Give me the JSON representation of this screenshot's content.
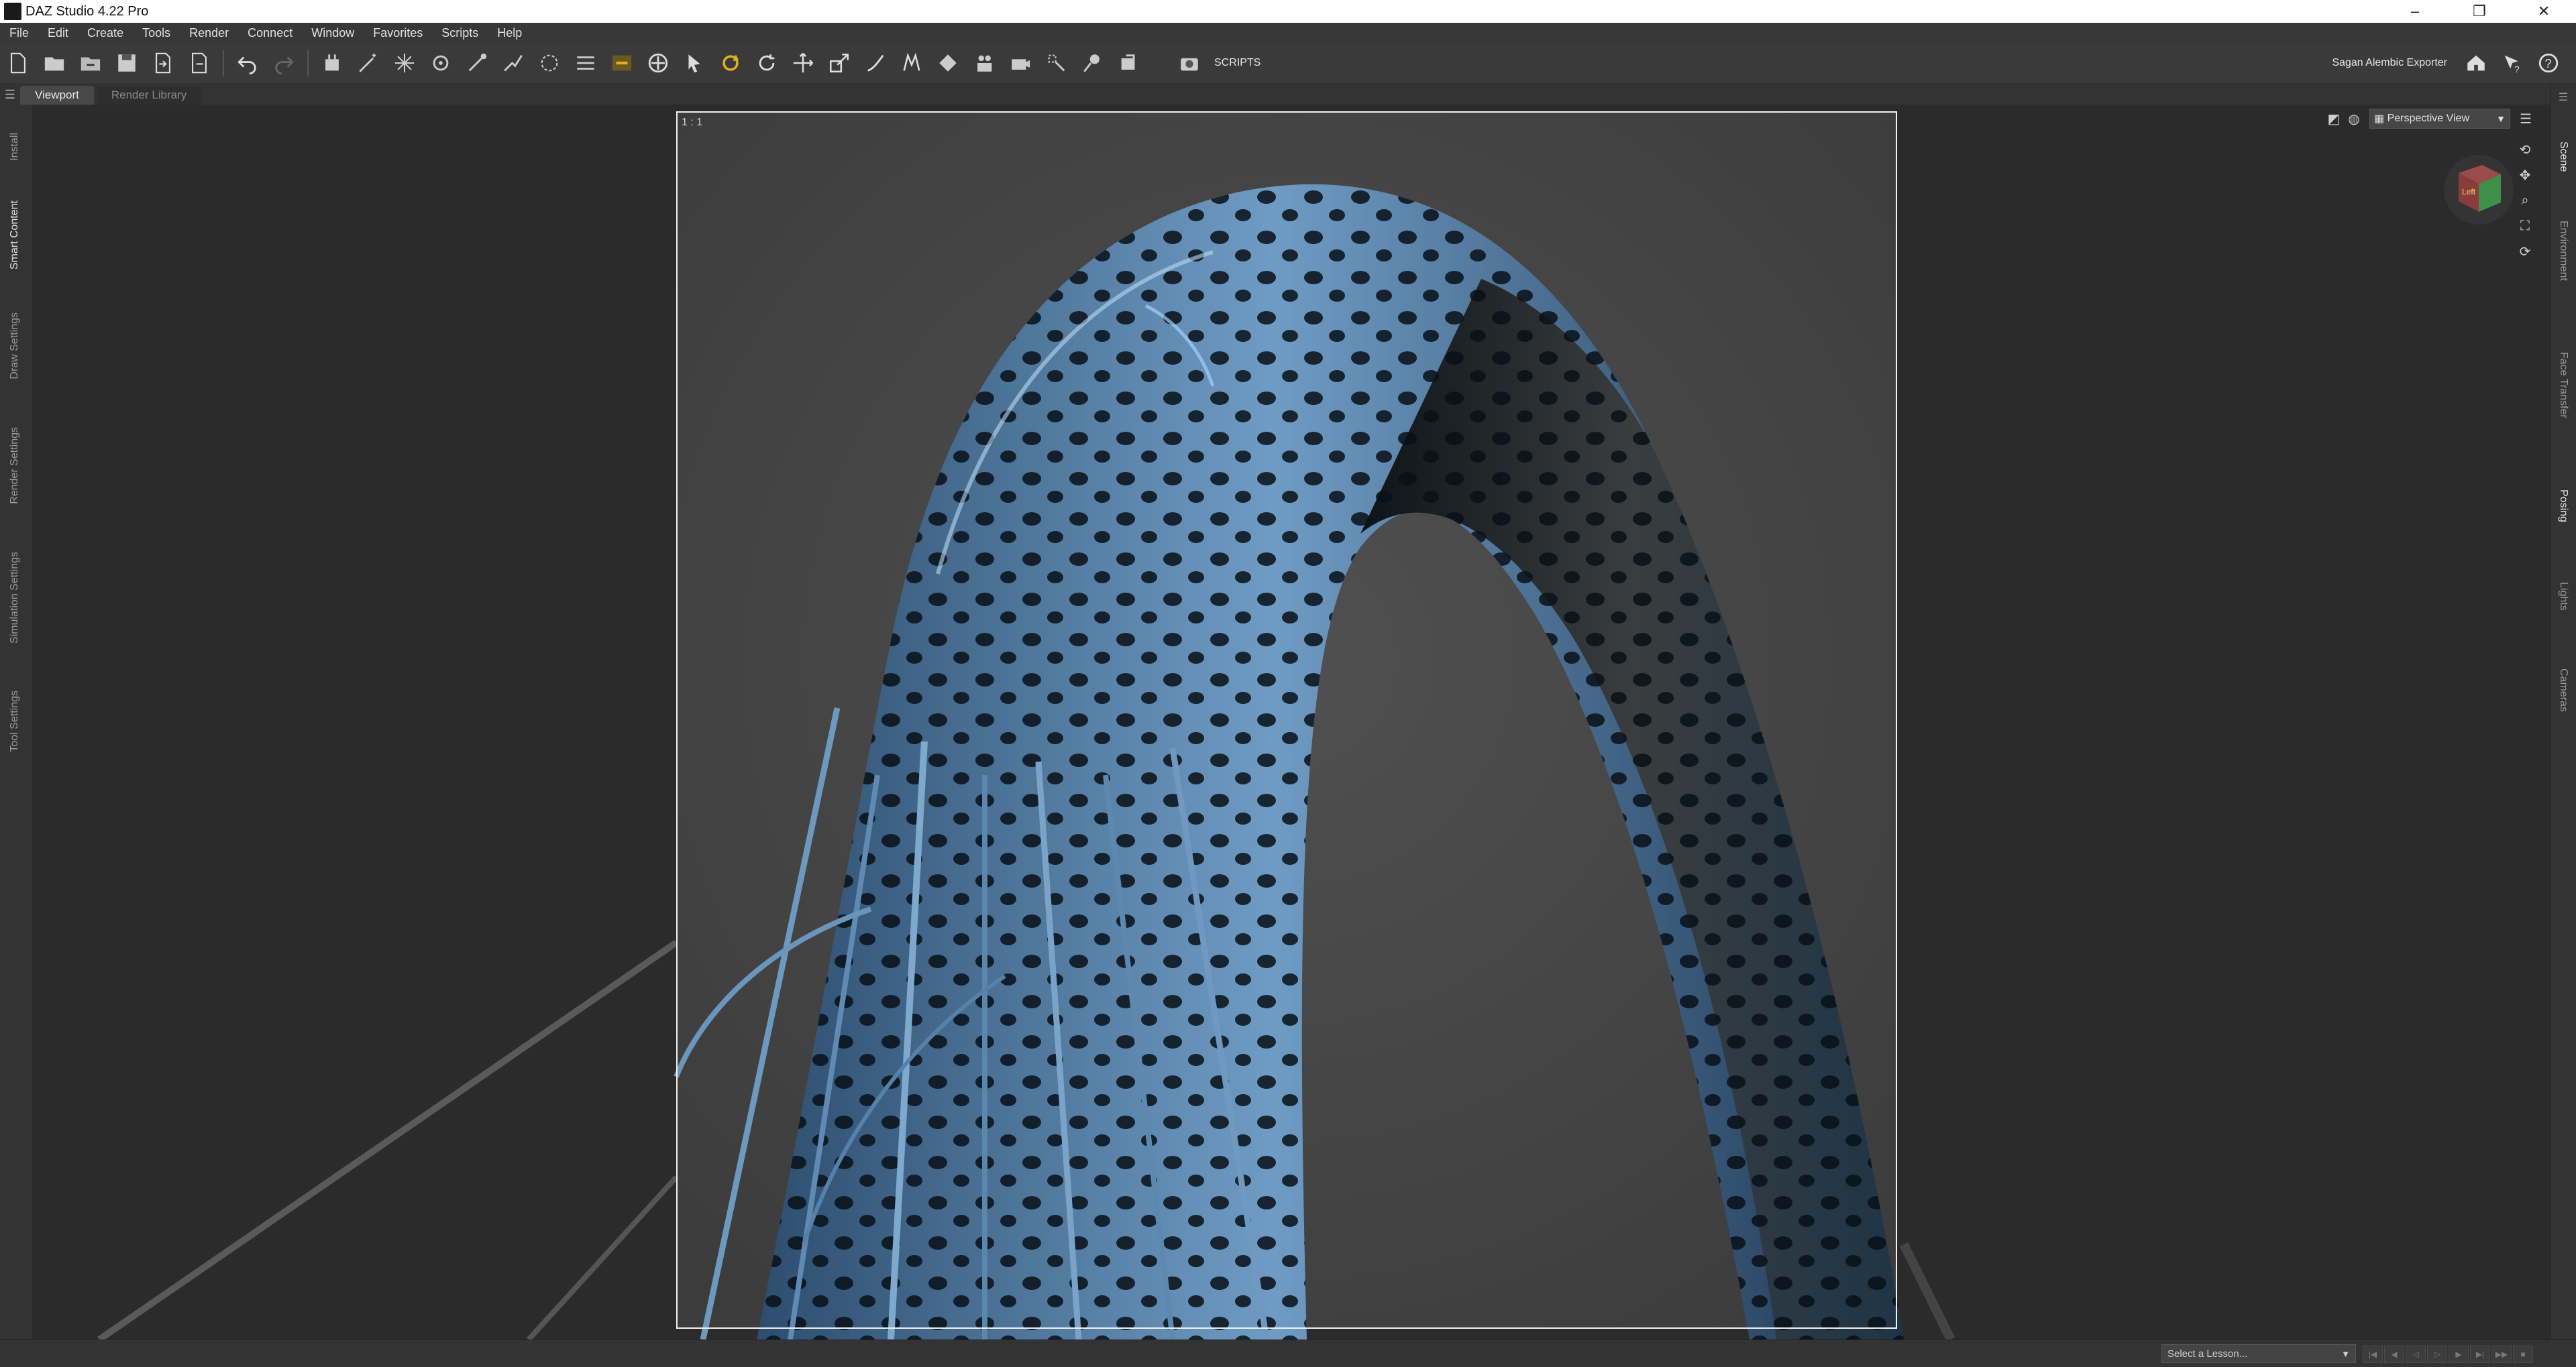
{
  "window": {
    "title": "DAZ Studio 4.22 Pro",
    "controls": [
      "–",
      "❐",
      "✕"
    ]
  },
  "menubar": {
    "items": [
      "File",
      "Edit",
      "Create",
      "Tools",
      "Render",
      "Connect",
      "Window",
      "Favorites",
      "Scripts",
      "Help"
    ]
  },
  "toolbar": {
    "scripts_label": "SCRIPTS",
    "exporter_label": "Sagan Alembic Exporter"
  },
  "tabs": {
    "viewport": "Viewport",
    "render_library": "Render Library"
  },
  "left_tabs": [
    "Install",
    "Smart Content",
    "Draw Settings",
    "Render Settings",
    "Simulation Settings",
    "Tool Settings"
  ],
  "right_tabs": [
    "Scene",
    "Environment",
    "Face Transfer",
    "Posing",
    "Lights",
    "Cameras"
  ],
  "viewport": {
    "aspect_label": "1 : 1",
    "view_select": "Perspective View",
    "cube_face_label": "Left"
  },
  "statusbar": {
    "lesson_placeholder": "Select a Lesson..."
  },
  "colors": {
    "frame": "#f2f2f2",
    "scene_background": "#4a4a4a",
    "accent_icon": "#e0b020"
  }
}
